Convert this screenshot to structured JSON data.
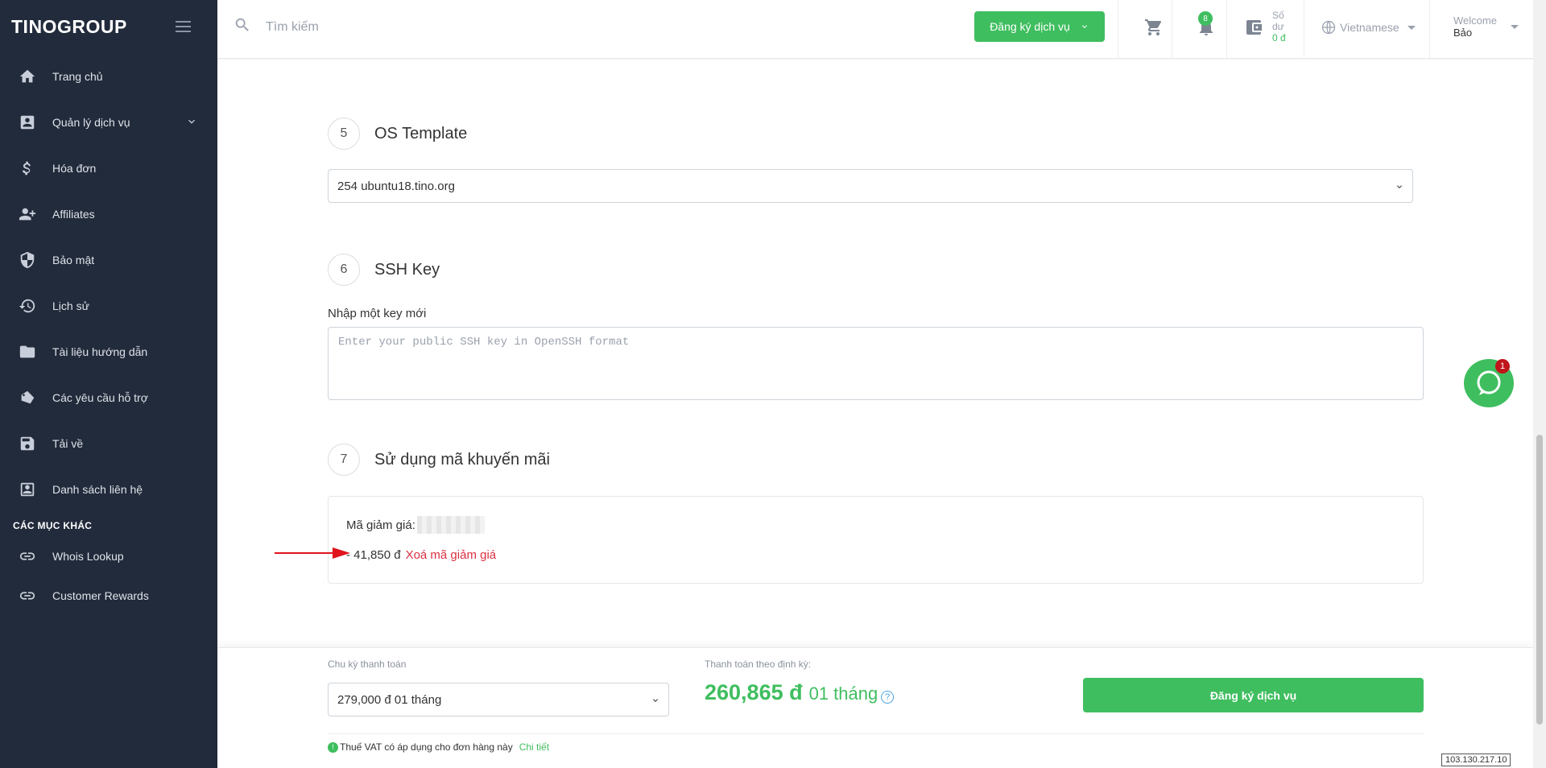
{
  "brand": {
    "logo_text": "TINOGROUP"
  },
  "sidebar": {
    "items": [
      {
        "label": "Trang chủ",
        "icon": "home-icon"
      },
      {
        "label": "Quản lý dịch vụ",
        "icon": "account-box-icon"
      },
      {
        "label": "Hóa đơn",
        "icon": "dollar-icon"
      },
      {
        "label": "Affiliates",
        "icon": "users-plus-icon"
      },
      {
        "label": "Bảo mật",
        "icon": "shield-icon"
      },
      {
        "label": "Lịch sử",
        "icon": "history-icon"
      },
      {
        "label": "Tài liệu hướng dẫn",
        "icon": "document-icon"
      },
      {
        "label": "Các yêu cầu hỗ trợ",
        "icon": "ticket-icon"
      },
      {
        "label": "Tải về",
        "icon": "save-icon"
      },
      {
        "label": "Danh sách liên hệ",
        "icon": "contact-icon"
      }
    ],
    "section_title": "CÁC MỤC KHÁC",
    "other_items": [
      {
        "label": "Whois Lookup",
        "icon": "link-icon"
      },
      {
        "label": "Customer Rewards",
        "icon": "link-icon"
      }
    ]
  },
  "topbar": {
    "search_placeholder": "Tìm kiếm",
    "register_button": "Đăng ký dịch vụ",
    "notification_count": "8",
    "balance_label": "Số dư",
    "balance_amount": "0 đ",
    "language": "Vietnamese",
    "welcome_label": "Welcome",
    "user_name": "Bảo"
  },
  "steps": {
    "os": {
      "number": "5",
      "title": "OS Template",
      "selected": "254 ubuntu18.tino.org"
    },
    "ssh": {
      "number": "6",
      "title": "SSH Key",
      "label": "Nhập một key mới",
      "placeholder": "Enter your public SSH key in OpenSSH format"
    },
    "promo": {
      "number": "7",
      "title": "Sử dụng mã khuyến mãi",
      "code_label": "Mã giảm giá:",
      "discount": "- 41,850 đ",
      "remove_label": "Xoá mã giảm giá"
    }
  },
  "footer": {
    "cycle_label": "Chu kỳ thanh toán",
    "cycle_selected": "279,000 đ 01 tháng",
    "recurring_label": "Thanh toán theo định kỳ:",
    "recurring_amount": "260,865 đ",
    "recurring_period": "01 tháng",
    "help_symbol": "?",
    "register_button": "Đăng ký dịch vụ",
    "vat_text": "Thuế VAT có áp dụng cho đơn hàng này",
    "vat_link": "Chi tiết"
  },
  "chat": {
    "badge": "1"
  },
  "ip_address": "103.130.217.10",
  "colors": {
    "sidebar_bg": "#222b3b",
    "accent_green": "#3fbe5f",
    "danger_red": "#d93040"
  }
}
